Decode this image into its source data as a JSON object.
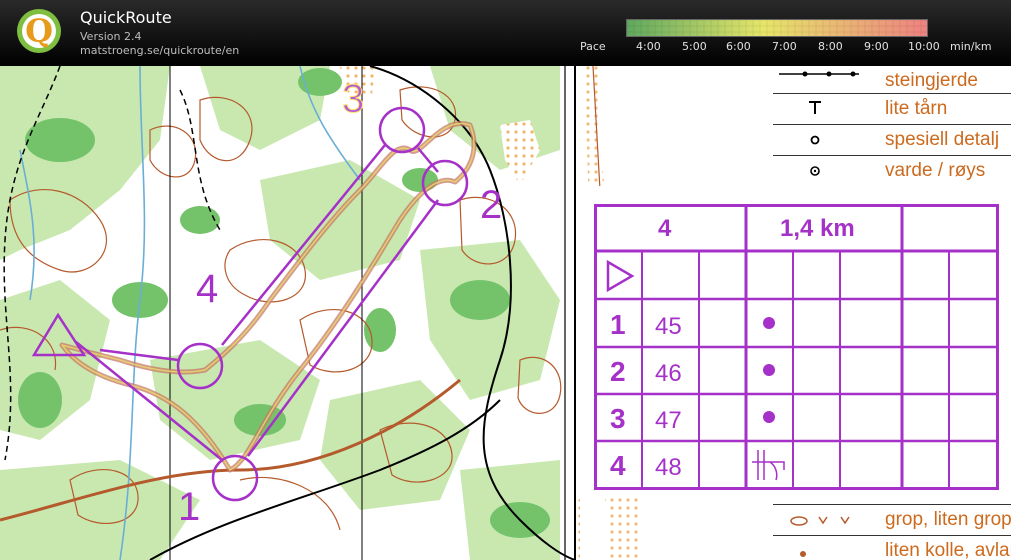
{
  "app": {
    "title": "QuickRoute",
    "version": "Version 2.4",
    "url": "matstroeng.se/quickroute/en",
    "logo_letter": "Q"
  },
  "pace": {
    "label": "Pace",
    "ticks": [
      "4:00",
      "5:00",
      "6:00",
      "7:00",
      "8:00",
      "9:00",
      "10:00"
    ],
    "unit": "min/km",
    "colors": {
      "fast": "#5fa85f",
      "mid": "#e6e66a",
      "slow": "#ee8080"
    }
  },
  "map": {
    "colors": {
      "forest": "#ffffff",
      "green_light": "#c8e8b0",
      "green_dark": "#74c36a",
      "contour": "#b55a2c",
      "course": "#a531c8",
      "route": "#c87a6a",
      "road": "#000000",
      "water": "#6aaed6"
    },
    "control_numbers": [
      "1",
      "2",
      "3",
      "4"
    ]
  },
  "legend": {
    "items": [
      {
        "icon": "stone-wall-icon",
        "label": "steingjerde"
      },
      {
        "icon": "small-tower-icon",
        "label": "lite tårn"
      },
      {
        "icon": "special-feature-icon",
        "label": "spesiell detalj"
      },
      {
        "icon": "cairn-icon",
        "label": "varde / røys"
      },
      {
        "icon": "pit-icon",
        "label": "grop, liten grop"
      },
      {
        "icon": "knoll-icon",
        "label": "liten kolle, avlang"
      }
    ]
  },
  "control_description": {
    "event": "4",
    "length": "1,4 km",
    "start_symbol": "start-triangle-icon",
    "rows": [
      {
        "number": "1",
        "code": "45",
        "feature": "dot"
      },
      {
        "number": "2",
        "code": "46",
        "feature": "dot"
      },
      {
        "number": "3",
        "code": "47",
        "feature": "dot"
      },
      {
        "number": "4",
        "code": "48",
        "feature": "tower"
      }
    ]
  }
}
